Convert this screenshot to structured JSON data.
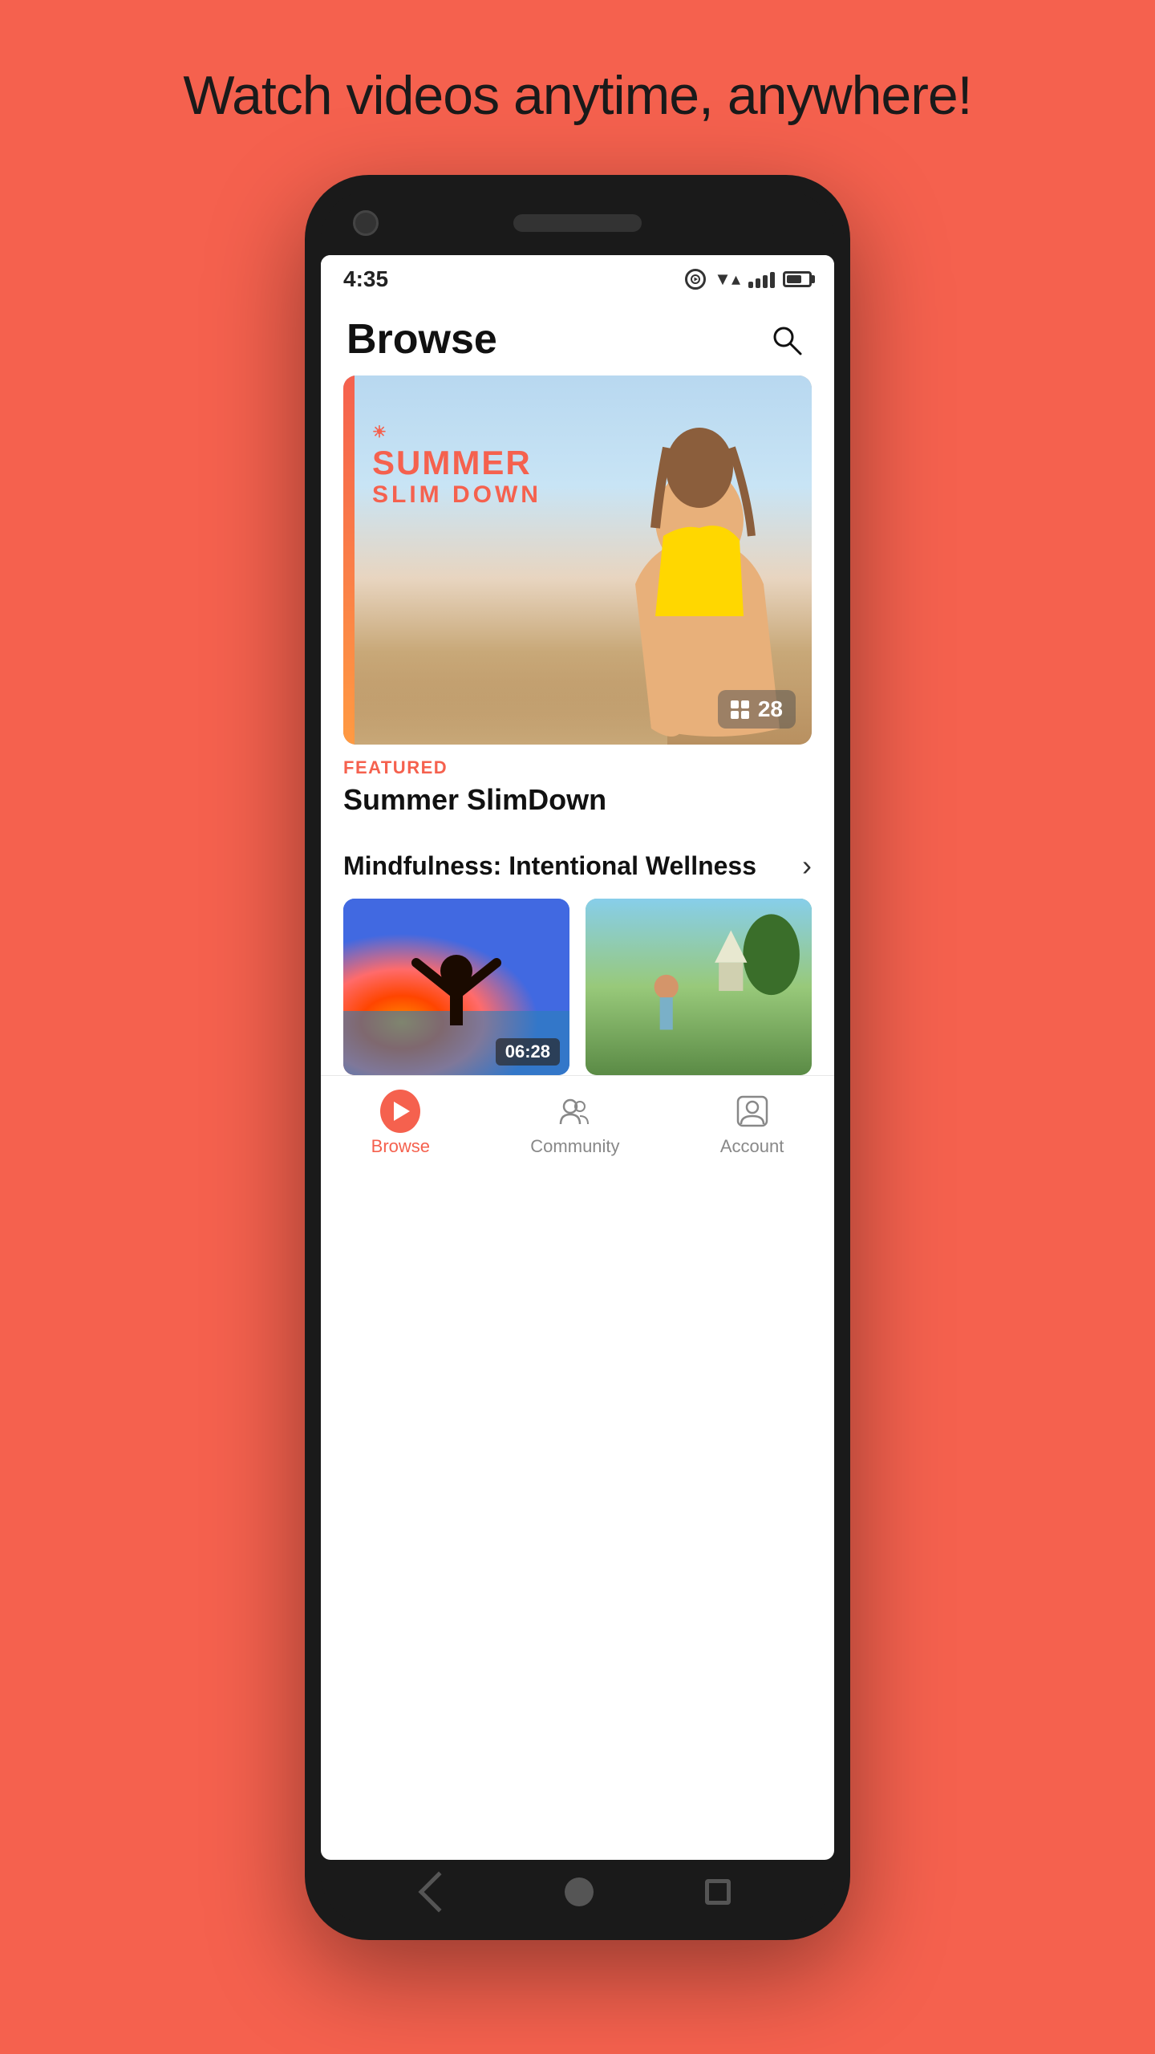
{
  "page": {
    "background_color": "#F5614E",
    "tagline": "Watch videos anytime, anywhere!"
  },
  "status_bar": {
    "time": "4:35",
    "wifi": "▼",
    "signal": "signal",
    "battery": "battery"
  },
  "header": {
    "title": "Browse",
    "search_label": "search"
  },
  "featured": {
    "label": "FEATURED",
    "title": "Summer SlimDown",
    "program_name": "SUMMER",
    "program_sub": "SLIM DOWN",
    "video_count": "28",
    "accent_color": "#F5614E"
  },
  "sections": [
    {
      "title": "Mindfulness: Intentional Wellness",
      "has_arrow": true
    }
  ],
  "videos": [
    {
      "duration": "06:28"
    },
    {
      "duration": ""
    }
  ],
  "bottom_nav": {
    "items": [
      {
        "label": "Browse",
        "active": true
      },
      {
        "label": "Community",
        "active": false
      },
      {
        "label": "Account",
        "active": false
      }
    ]
  },
  "phone_nav": {
    "back": "back",
    "home": "home",
    "recent": "recent"
  }
}
